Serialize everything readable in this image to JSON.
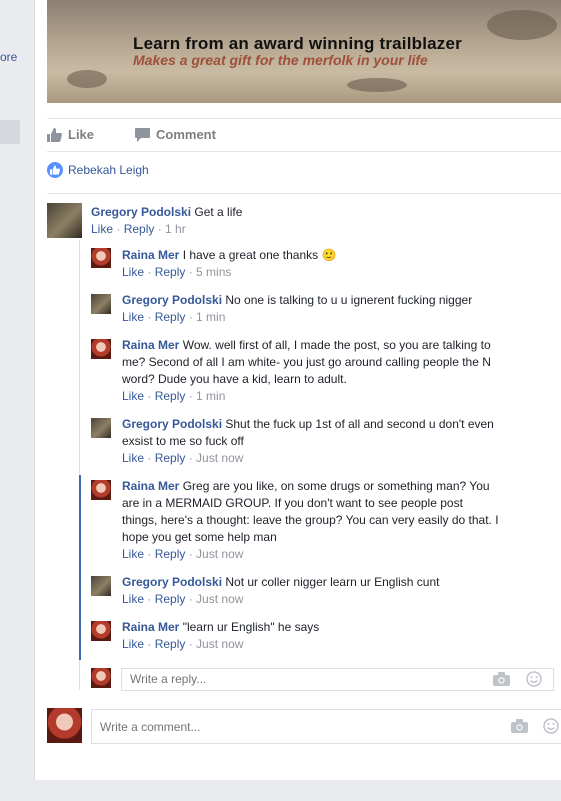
{
  "sidebar": {
    "more_label": "ore"
  },
  "post": {
    "image_text_line1": "Learn from an award winning trailblazer",
    "image_text_line2": "Makes a great gift for the merfolk in your life",
    "actions": {
      "like": "Like",
      "comment": "Comment"
    },
    "likers": "Rebekah Leigh"
  },
  "comments": [
    {
      "author": "Gregory Podolski",
      "text": "Get a life",
      "like": "Like",
      "reply": "Reply",
      "time": "1 hr"
    }
  ],
  "replies": [
    {
      "author": "Raina Mer",
      "text": "I have a great one thanks",
      "emoji": "🙂",
      "like": "Like",
      "reply": "Reply",
      "time": "5 mins"
    },
    {
      "author": "Gregory Podolski",
      "text": "No one is talking to u u ignerent fucking nigger",
      "like": "Like",
      "reply": "Reply",
      "time": "1 min"
    },
    {
      "author": "Raina Mer",
      "text_lines": [
        "Wow. well first of all, I made the post, so you are talking to",
        "me? Second of all I am white- you just go around calling people the N",
        "word? Dude you have a kid, learn to adult."
      ],
      "like": "Like",
      "reply": "Reply",
      "time": "1 min"
    },
    {
      "author": "Gregory Podolski",
      "text_lines": [
        "Shut the fuck up 1st of all and second u don't even",
        "exsist to me so fuck off"
      ],
      "like": "Like",
      "reply": "Reply",
      "time": "Just now"
    },
    {
      "author": "Raina Mer",
      "text_lines": [
        "Greg are you like, on some drugs or something man? You",
        "are in a MERMAID GROUP. If you don't want to see people post",
        "things, here's a thought: leave the group? You can very easily do that. I",
        "hope you get some help man"
      ],
      "like": "Like",
      "reply": "Reply",
      "time": "Just now"
    },
    {
      "author": "Gregory Podolski",
      "text": "Not ur coller nigger learn ur English cunt",
      "like": "Like",
      "reply": "Reply",
      "time": "Just now"
    },
    {
      "author": "Raina Mer",
      "text": "\"learn ur English\" he says",
      "like": "Like",
      "reply": "Reply",
      "time": "Just now"
    }
  ],
  "reply_input": {
    "placeholder": "Write a reply..."
  },
  "comment_input": {
    "placeholder": "Write a comment..."
  },
  "icons": {
    "camera": "camera-icon",
    "emoji": "emoji-icon",
    "like": "thumbs-up-icon",
    "comment": "comment-icon"
  },
  "colors": {
    "link": "#365899",
    "meta": "#90949c",
    "thread": "#4267b2",
    "like_badge": "#5890ff"
  }
}
